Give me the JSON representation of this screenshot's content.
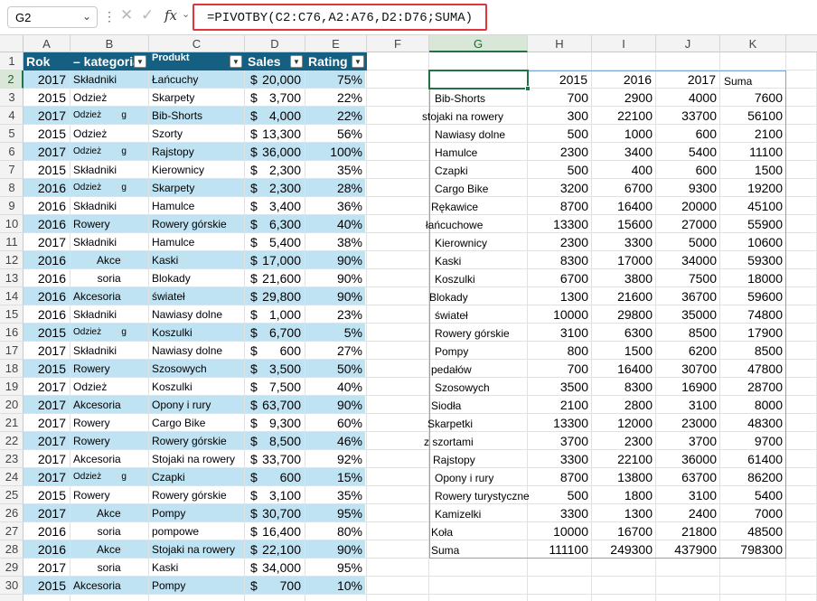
{
  "namebox": {
    "value": "G2"
  },
  "formula_bar": {
    "fx_label": "fx",
    "formula": "=PIVOTBY(C2:C76,A2:A76,D2:D76;SUMA)"
  },
  "columns": [
    "A",
    "B",
    "C",
    "D",
    "E",
    "F",
    "G",
    "H",
    "I",
    "J",
    "K"
  ],
  "rows": [
    "1",
    "2",
    "3",
    "4",
    "5",
    "6",
    "7",
    "8",
    "9",
    "10",
    "11",
    "12",
    "13",
    "14",
    "15",
    "16",
    "17",
    "18",
    "19",
    "20",
    "21",
    "22",
    "23",
    "24",
    "25",
    "26",
    "27",
    "28",
    "29",
    "30"
  ],
  "table": {
    "headers": {
      "rok": "Rok",
      "kategoria": "– kategoria",
      "produkt": "Produkt",
      "sales": "Sales",
      "rating": "Rating"
    },
    "rows": [
      {
        "rok": "2017",
        "kategoria": "Składniki",
        "produkt": "Łańcuchy",
        "currency": "$",
        "sales": "20,000",
        "rating": "75%"
      },
      {
        "rok": "2015",
        "kategoria": "Odzież",
        "produkt": "Skarpety",
        "currency": "$",
        "sales": "3,700",
        "rating": "22%"
      },
      {
        "rok": "2017",
        "kategoria": "Odzież        g",
        "produkt": "Bib-Shorts",
        "currency": "$",
        "sales": "4,000",
        "rating": "22%"
      },
      {
        "rok": "2015",
        "kategoria": "Odzież",
        "produkt": "Szorty",
        "currency": "$",
        "sales": "13,300",
        "rating": "56%"
      },
      {
        "rok": "2017",
        "kategoria": "Odzież        g",
        "produkt": "Rajstopy",
        "currency": "$",
        "sales": "36,000",
        "rating": "100%"
      },
      {
        "rok": "2015",
        "kategoria": "Składniki",
        "produkt": "Kierownicy",
        "currency": "$",
        "sales": "2,300",
        "rating": "35%"
      },
      {
        "rok": "2016",
        "kategoria": "Odzież        g",
        "produkt": "Skarpety",
        "currency": "$",
        "sales": "2,300",
        "rating": "28%"
      },
      {
        "rok": "2016",
        "kategoria": "Składniki",
        "produkt": "Hamulce",
        "currency": "$",
        "sales": "3,400",
        "rating": "36%"
      },
      {
        "rok": "2016",
        "kategoria": "Rowery",
        "produkt": "Rowery górskie",
        "currency": "$",
        "sales": "6,300",
        "rating": "40%"
      },
      {
        "rok": "2017",
        "kategoria": "Składniki",
        "produkt": "Hamulce",
        "currency": "$",
        "sales": "5,400",
        "rating": "38%"
      },
      {
        "rok": "2016",
        "kategoria": "        Akce",
        "produkt": "Kaski",
        "currency": "$",
        "sales": "17,000",
        "rating": "90%"
      },
      {
        "rok": "2016",
        "kategoria": "        soria",
        "produkt": "Blokady",
        "currency": "$",
        "sales": "21,600",
        "rating": "90%"
      },
      {
        "rok": "2016",
        "kategoria": "Akcesoria",
        "produkt": "świateł",
        "currency": "$",
        "sales": "29,800",
        "rating": "90%"
      },
      {
        "rok": "2016",
        "kategoria": "Składniki",
        "produkt": "Nawiasy dolne",
        "currency": "$",
        "sales": "1,000",
        "rating": "23%"
      },
      {
        "rok": "2015",
        "kategoria": "Odzież        g",
        "produkt": "Koszulki",
        "currency": "$",
        "sales": "6,700",
        "rating": "5%"
      },
      {
        "rok": "2017",
        "kategoria": "Składniki",
        "produkt": "Nawiasy dolne",
        "currency": "$",
        "sales": "600",
        "rating": "27%"
      },
      {
        "rok": "2015",
        "kategoria": "Rowery",
        "produkt": "Szosowych",
        "currency": "$",
        "sales": "3,500",
        "rating": "50%"
      },
      {
        "rok": "2017",
        "kategoria": "Odzież",
        "produkt": "Koszulki",
        "currency": "$",
        "sales": "7,500",
        "rating": "40%"
      },
      {
        "rok": "2017",
        "kategoria": "Akcesoria",
        "produkt": "Opony i rury",
        "currency": "$",
        "sales": "63,700",
        "rating": "90%"
      },
      {
        "rok": "2017",
        "kategoria": "Rowery",
        "produkt": "Cargo Bike",
        "currency": "$",
        "sales": "9,300",
        "rating": "60%"
      },
      {
        "rok": "2017",
        "kategoria": "Rowery",
        "produkt": "Rowery górskie",
        "currency": "$",
        "sales": "8,500",
        "rating": "46%"
      },
      {
        "rok": "2017",
        "kategoria": "Akcesoria",
        "produkt": "Stojaki na rowery",
        "currency": "$",
        "sales": "33,700",
        "rating": "92%"
      },
      {
        "rok": "2017",
        "kategoria": "Odzież        g",
        "produkt": "Czapki",
        "currency": "$",
        "sales": "600",
        "rating": "15%"
      },
      {
        "rok": "2015",
        "kategoria": "Rowery",
        "produkt": "Rowery górskie",
        "currency": "$",
        "sales": "3,100",
        "rating": "35%"
      },
      {
        "rok": "2017",
        "kategoria": "        Akce",
        "produkt": "Pompy",
        "currency": "$",
        "sales": "30,700",
        "rating": "95%"
      },
      {
        "rok": "2016",
        "kategoria": "        soria",
        "produkt": "pompowe",
        "currency": "$",
        "sales": "16,400",
        "rating": "80%"
      },
      {
        "rok": "2016",
        "kategoria": "        Akce",
        "produkt": "Stojaki na rowery",
        "currency": "$",
        "sales": "22,100",
        "rating": "90%"
      },
      {
        "rok": "2017",
        "kategoria": "        soria",
        "produkt": "Kaski",
        "currency": "$",
        "sales": "34,000",
        "rating": "95%"
      },
      {
        "rok": "2015",
        "kategoria": "Akcesoria",
        "produkt": "Pompy",
        "currency": "$",
        "sales": "700",
        "rating": "10%"
      }
    ]
  },
  "pivot": {
    "header": [
      "",
      "2015",
      "2016",
      "2017",
      "Suma"
    ],
    "rows": [
      {
        "label": "Bib-Shorts",
        "v2015": "700",
        "v2016": "2900",
        "v2017": "4000",
        "suma": "7600"
      },
      {
        "label": "stojaki na rowery",
        "v2015": "300",
        "v2016": "22100",
        "v2017": "33700",
        "suma": "56100"
      },
      {
        "label": "Nawiasy dolne",
        "v2015": "500",
        "v2016": "1000",
        "v2017": "600",
        "suma": "2100"
      },
      {
        "label": "Hamulce",
        "v2015": "2300",
        "v2016": "3400",
        "v2017": "5400",
        "suma": "11100"
      },
      {
        "label": "Czapki",
        "v2015": "500",
        "v2016": "400",
        "v2017": "600",
        "suma": "1500"
      },
      {
        "label": "Cargo Bike",
        "v2015": "3200",
        "v2016": "6700",
        "v2017": "9300",
        "suma": "19200"
      },
      {
        "label": "Rękawice",
        "v2015": "8700",
        "v2016": "16400",
        "v2017": "20000",
        "suma": "45100"
      },
      {
        "label": "łańcuchowe",
        "v2015": "13300",
        "v2016": "15600",
        "v2017": "27000",
        "suma": "55900"
      },
      {
        "label": "Kierownicy",
        "v2015": "2300",
        "v2016": "3300",
        "v2017": "5000",
        "suma": "10600"
      },
      {
        "label": "Kaski",
        "v2015": "8300",
        "v2016": "17000",
        "v2017": "34000",
        "suma": "59300"
      },
      {
        "label": "Koszulki",
        "v2015": "6700",
        "v2016": "3800",
        "v2017": "7500",
        "suma": "18000"
      },
      {
        "label": "Blokady",
        "v2015": "1300",
        "v2016": "21600",
        "v2017": "36700",
        "suma": "59600"
      },
      {
        "label": "świateł",
        "v2015": "10000",
        "v2016": "29800",
        "v2017": "35000",
        "suma": "74800"
      },
      {
        "label": "Rowery górskie",
        "v2015": "3100",
        "v2016": "6300",
        "v2017": "8500",
        "suma": "17900"
      },
      {
        "label": "Pompy",
        "v2015": "800",
        "v2016": "1500",
        "v2017": "6200",
        "suma": "8500"
      },
      {
        "label": "pedałów",
        "v2015": "700",
        "v2016": "16400",
        "v2017": "30700",
        "suma": "47800"
      },
      {
        "label": "Szosowych",
        "v2015": "3500",
        "v2016": "8300",
        "v2017": "16900",
        "suma": "28700"
      },
      {
        "label": "Siodła",
        "v2015": "2100",
        "v2016": "2800",
        "v2017": "3100",
        "suma": "8000"
      },
      {
        "label": "Skarpetki",
        "v2015": "13300",
        "v2016": "12000",
        "v2017": "23000",
        "suma": "48300"
      },
      {
        "label": "z szortami",
        "v2015": "3700",
        "v2016": "2300",
        "v2017": "3700",
        "suma": "9700"
      },
      {
        "label": "Rajstopy",
        "v2015": "3300",
        "v2016": "22100",
        "v2017": "36000",
        "suma": "61400"
      },
      {
        "label": "Opony i rury",
        "v2015": "8700",
        "v2016": "13800",
        "v2017": "63700",
        "suma": "86200"
      },
      {
        "label": "Rowery turystyczne",
        "v2015": "500",
        "v2016": "1800",
        "v2017": "3100",
        "suma": "5400"
      },
      {
        "label": "Kamizelki",
        "v2015": "3300",
        "v2016": "1300",
        "v2017": "2400",
        "suma": "7000"
      },
      {
        "label": "Koła",
        "v2015": "10000",
        "v2016": "16700",
        "v2017": "21800",
        "suma": "48500"
      },
      {
        "label": "Suma",
        "v2015": "111100",
        "v2016": "249300",
        "v2017": "437900",
        "suma": "798300"
      }
    ]
  },
  "colors": {
    "table_header": "#156082",
    "band": "#bfe3f3",
    "selection": "#217346",
    "formula_highlight": "#e0353a"
  }
}
